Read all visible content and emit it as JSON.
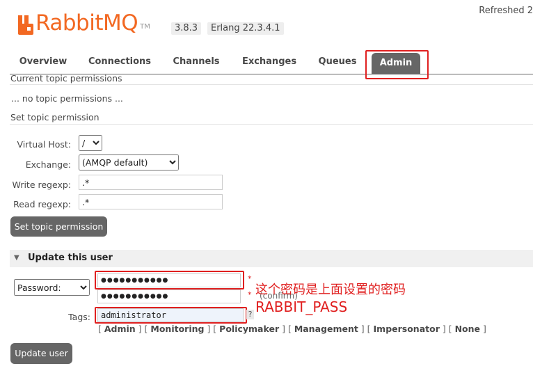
{
  "header": {
    "logo_text": "RabbitMQ",
    "logo_tm": "TM",
    "version": "3.8.3",
    "erlang": "Erlang 22.3.4.1",
    "refreshed": "Refreshed 2"
  },
  "tabs": [
    {
      "label": "Overview"
    },
    {
      "label": "Connections"
    },
    {
      "label": "Channels"
    },
    {
      "label": "Exchanges"
    },
    {
      "label": "Queues"
    },
    {
      "label": "Admin",
      "active": true
    }
  ],
  "topic_permissions": {
    "current_title": "Current topic permissions",
    "none_text": "... no topic permissions ...",
    "set_title": "Set topic permission",
    "virtual_host_label": "Virtual Host:",
    "virtual_host_value": "/",
    "exchange_label": "Exchange:",
    "exchange_value": "(AMQP default)",
    "write_label": "Write regexp:",
    "write_value": ".*",
    "read_label": "Read regexp:",
    "read_value": ".*",
    "submit_label": "Set topic permission"
  },
  "update_user": {
    "title": "Update this user",
    "password_option": "Password:",
    "password_value": "●●●●●●●●●●●",
    "confirm_value": "●●●●●●●●●●●",
    "confirm_label": "(confirm)",
    "required_star": "*",
    "tags_label": "Tags:",
    "tags_value": "administrator",
    "help": "?",
    "tag_options": [
      "Admin",
      "Monitoring",
      "Policymaker",
      "Management",
      "Impersonator",
      "None"
    ],
    "submit_label": "Update user"
  },
  "annotation": {
    "line1": "这个密码是上面设置的密码",
    "line2": "RABBIT_PASS"
  },
  "colors": {
    "brand": "#f26822",
    "tab_active_bg": "#666666",
    "annotation": "#e02020"
  }
}
